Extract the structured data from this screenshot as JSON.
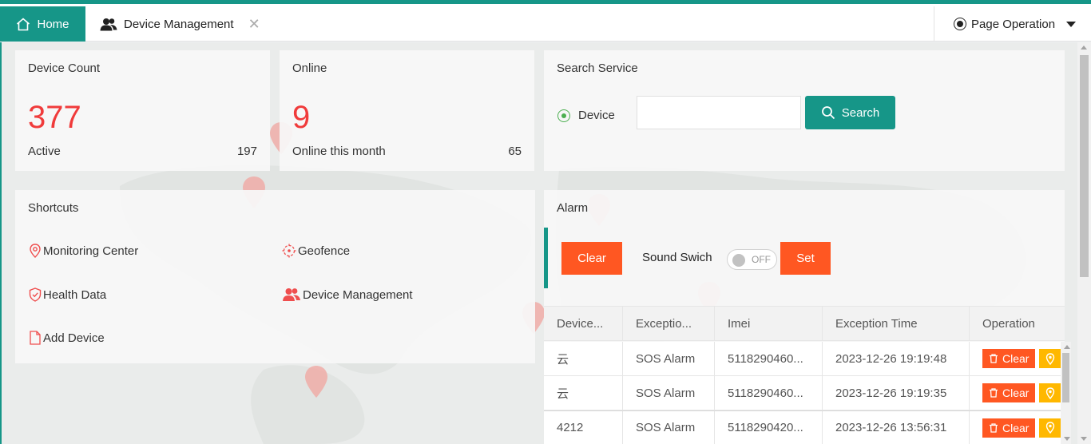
{
  "colors": {
    "primary": "#169688",
    "danger": "#ff5722",
    "warning": "#ffb800",
    "number_red": "#f03b3b"
  },
  "tabs": {
    "home": {
      "label": "Home",
      "icon": "home-icon"
    },
    "device": {
      "label": "Device Management",
      "icon": "users-icon",
      "close_glyph": "✕"
    }
  },
  "page_operation": {
    "label": "Page Operation"
  },
  "device_count": {
    "title": "Device Count",
    "value": "377",
    "sub_label": "Active",
    "sub_value": "197"
  },
  "online": {
    "title": "Online",
    "value": "9",
    "sub_label": "Online this month",
    "sub_value": "65"
  },
  "search_service": {
    "title": "Search Service",
    "radio_label": "Device",
    "input_value": "",
    "input_placeholder": "",
    "button_label": "Search"
  },
  "shortcuts": {
    "title": "Shortcuts",
    "items": [
      {
        "label": "Monitoring Center",
        "icon": "map-pin-icon"
      },
      {
        "label": "Geofence",
        "icon": "geofence-icon"
      },
      {
        "label": "Health Data",
        "icon": "shield-icon"
      },
      {
        "label": "Device Management",
        "icon": "users-icon"
      },
      {
        "label": "Add Device",
        "icon": "file-icon"
      }
    ]
  },
  "alarm": {
    "title": "Alarm",
    "clear_label": "Clear",
    "sound_label": "Sound Swich",
    "toggle_text": "OFF",
    "set_label": "Set",
    "table": {
      "headers": [
        "Device...",
        "Exceptio...",
        "Imei",
        "Exception Time",
        "Operation"
      ],
      "rows": [
        {
          "device": "云",
          "exception": "SOS Alarm",
          "imei": "5118290460...",
          "time": "2023-12-26 19:19:48",
          "op_label": "Clear"
        },
        {
          "device": "云",
          "exception": "SOS Alarm",
          "imei": "5118290460...",
          "time": "2023-12-26 19:19:35",
          "op_label": "Clear"
        },
        {
          "device": "4212",
          "exception": "SOS Alarm",
          "imei": "5118290420...",
          "time": "2023-12-26 13:56:31",
          "op_label": "Clear"
        }
      ]
    }
  }
}
